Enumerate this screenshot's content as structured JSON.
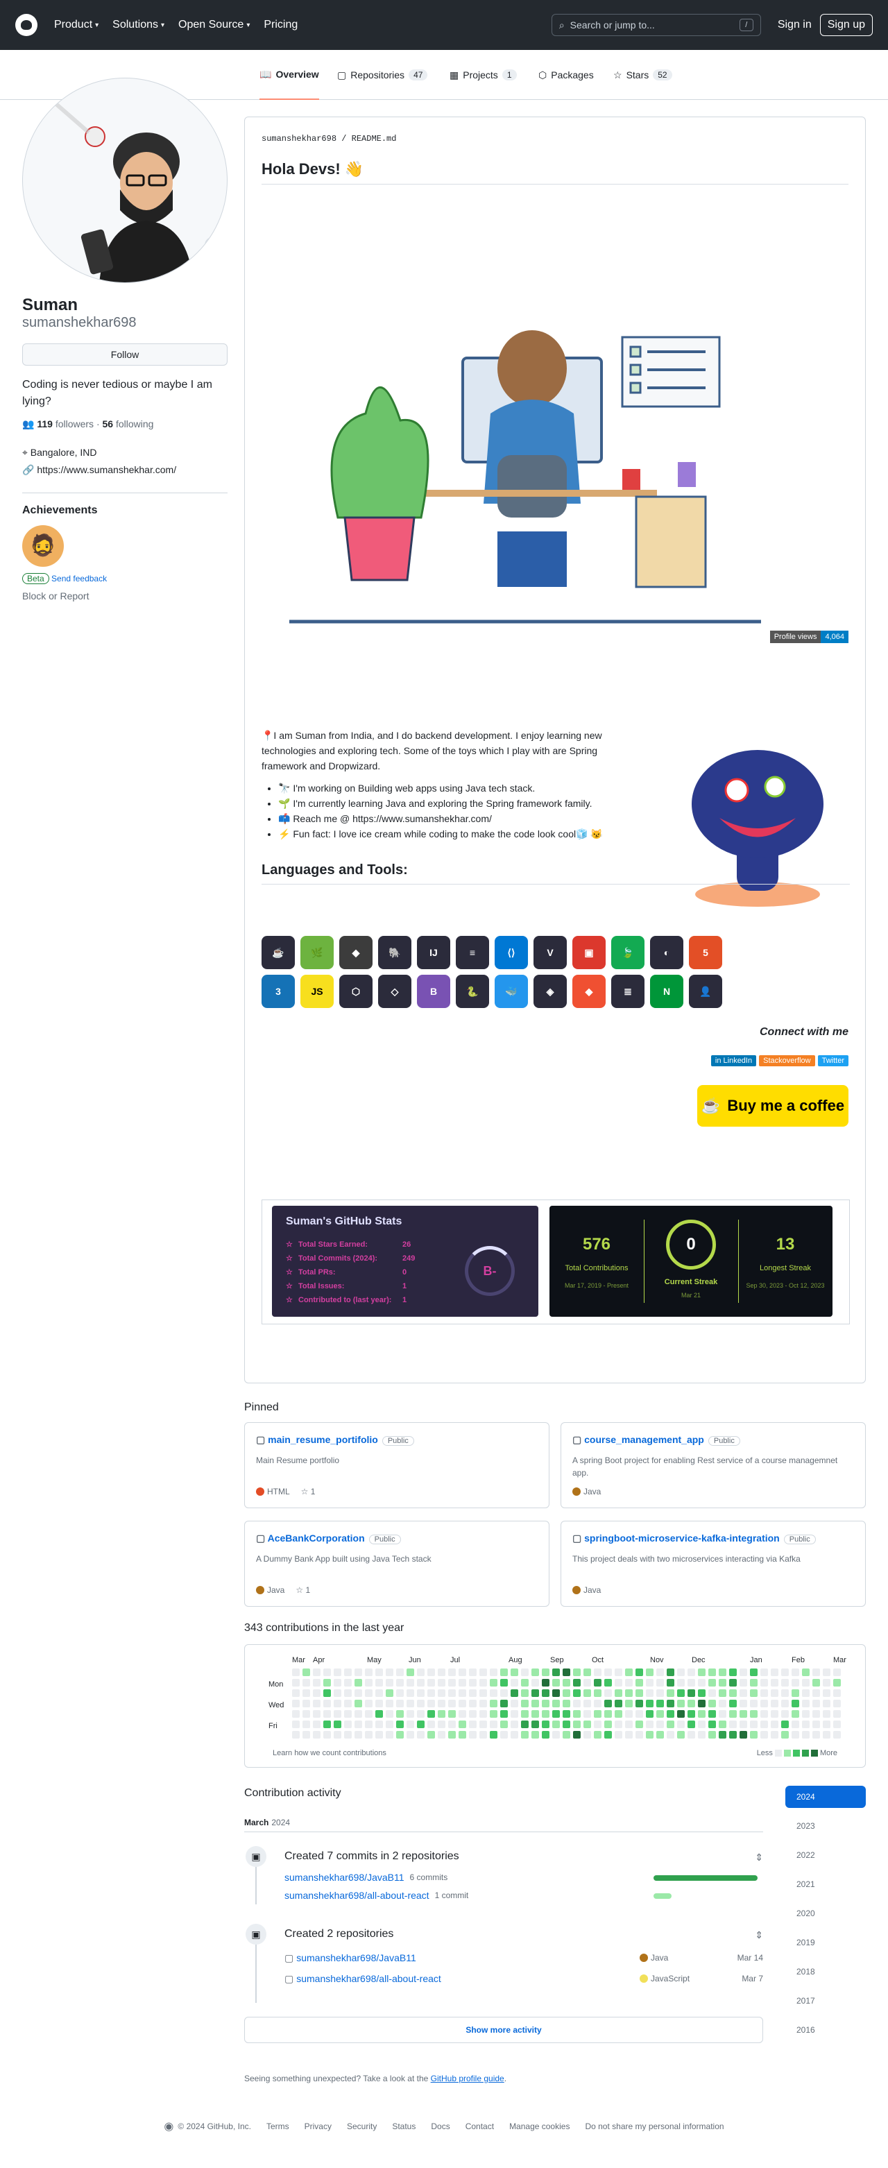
{
  "header": {
    "nav": [
      "Product",
      "Solutions",
      "Open Source",
      "Pricing"
    ],
    "search_placeholder": "Search or jump to...",
    "search_key": "/",
    "signin": "Sign in",
    "signup": "Sign up"
  },
  "tabs": [
    {
      "label": "Overview"
    },
    {
      "label": "Repositories",
      "count": "47"
    },
    {
      "label": "Projects",
      "count": "1"
    },
    {
      "label": "Packages"
    },
    {
      "label": "Stars",
      "count": "52"
    }
  ],
  "profile": {
    "name": "Suman",
    "login": "sumanshekhar698",
    "follow": "Follow",
    "bio": "Coding is never tedious or maybe I am lying?",
    "followers": "119",
    "followers_label": "followers",
    "following": "56",
    "following_label": "following",
    "location": "Bangalore, IND",
    "website": "https://www.sumanshekhar.com/",
    "achievements": "Achievements",
    "beta": "Beta",
    "feedback": "Send feedback",
    "block": "Block or Report"
  },
  "readme": {
    "path_user": "sumanshekhar698",
    "path_file": "README.md",
    "title": "Hola Devs! 👋",
    "views_label": "Profile views",
    "views": "4,064",
    "intro": "📍I am Suman from India, and I do backend development. I enjoy learning new technologies and exploring tech. Some of the toys which I play with are Spring framework and Dropwizard.",
    "bullets": [
      "🔭 I'm working on Building web apps using Java tech stack.",
      "🌱 I'm currently learning Java and exploring the Spring framework family.",
      "📫 Reach me @ https://www.sumanshekhar.com/",
      "⚡ Fun fact: I love ice cream while coding to make the code look cool🧊 😼"
    ],
    "languages_title": "Languages and Tools:",
    "tools": [
      {
        "t": "☕",
        "c": "#2b2b3b"
      },
      {
        "t": "🌿",
        "c": "#6db33f"
      },
      {
        "t": "◆",
        "c": "#3c3c3c"
      },
      {
        "t": "🐘",
        "c": "#2b2b3b"
      },
      {
        "t": "IJ",
        "c": "#2b2b3b"
      },
      {
        "t": "≡",
        "c": "#2b2b3b"
      },
      {
        "t": "⟨⟩",
        "c": "#0078d4"
      },
      {
        "t": "V",
        "c": "#2b2b3b"
      },
      {
        "t": "▣",
        "c": "#dc382d"
      },
      {
        "t": "🍃",
        "c": "#13aa52"
      },
      {
        "t": "◐",
        "c": "#2b2b3b"
      },
      {
        "t": "5",
        "c": "#e34f26"
      },
      {
        "t": "3",
        "c": "#1572b6"
      },
      {
        "t": "JS",
        "c": "#f7df1e"
      },
      {
        "t": "⬡",
        "c": "#2b2b3b"
      },
      {
        "t": "◇",
        "c": "#2b2b3b"
      },
      {
        "t": "B",
        "c": "#7952b3"
      },
      {
        "t": "🐍",
        "c": "#2b2b3b"
      },
      {
        "t": "🐳",
        "c": "#2496ed"
      },
      {
        "t": "◈",
        "c": "#2b2b3b"
      },
      {
        "t": "◆",
        "c": "#f05032"
      },
      {
        "t": "≣",
        "c": "#2b2b3b"
      },
      {
        "t": "N",
        "c": "#009639"
      },
      {
        "t": "👤",
        "c": "#2b2b3b"
      }
    ],
    "connect": "Connect with me",
    "badges": [
      {
        "t": "in LinkedIn",
        "c": "#0077b5"
      },
      {
        "t": "Stackoverflow",
        "c": "#f48024"
      },
      {
        "t": "Twitter",
        "c": "#1da1f2"
      }
    ],
    "coffee": "Buy me a coffee",
    "stats": {
      "title": "Suman's GitHub Stats",
      "rows": [
        [
          "Total Stars Earned:",
          "26"
        ],
        [
          "Total Commits (2024):",
          "249"
        ],
        [
          "Total PRs:",
          "0"
        ],
        [
          "Total Issues:",
          "1"
        ],
        [
          "Contributed to (last year):",
          "1"
        ]
      ],
      "grade": "B-"
    },
    "streak": {
      "total": "576",
      "total_label": "Total Contributions",
      "total_range": "Mar 17, 2019 - Present",
      "current": "0",
      "current_label": "Current Streak",
      "current_range": "Mar 21",
      "longest": "13",
      "longest_label": "Longest Streak",
      "longest_range": "Sep 30, 2023 - Oct 12, 2023"
    }
  },
  "pinned": {
    "title": "Pinned",
    "items": [
      {
        "name": "main_resume_portifolio",
        "vis": "Public",
        "desc": "Main Resume portfolio",
        "lang": "HTML",
        "color": "#e34c26",
        "stars": "1"
      },
      {
        "name": "course_management_app",
        "vis": "Public",
        "desc": "A spring Boot project for enabling Rest service of a course managemnet app.",
        "lang": "Java",
        "color": "#b07219",
        "stars": ""
      },
      {
        "name": "AceBankCorporation",
        "vis": "Public",
        "desc": "A Dummy Bank App built using Java Tech stack",
        "lang": "Java",
        "color": "#b07219",
        "stars": "1"
      },
      {
        "name": "springboot-microservice-kafka-integration",
        "vis": "Public",
        "desc": "This project deals with two microservices interacting via Kafka",
        "lang": "Java",
        "color": "#b07219",
        "stars": ""
      }
    ]
  },
  "contrib": {
    "title": "343 contributions in the last year",
    "months": [
      "Mar",
      "Apr",
      "May",
      "Jun",
      "Jul",
      "Aug",
      "Sep",
      "Oct",
      "Nov",
      "Dec",
      "Jan",
      "Feb",
      "Mar"
    ],
    "days": [
      "Mon",
      "Wed",
      "Fri"
    ],
    "learn": "Learn how we count contributions",
    "less": "Less",
    "more": "More"
  },
  "activity": {
    "title": "Contribution activity",
    "month": "March",
    "year": "2024",
    "commits_title": "Created 7 commits in 2 repositories",
    "commits": [
      {
        "repo": "sumanshekhar698/JavaB11",
        "n": "6 commits",
        "frac": 1
      },
      {
        "repo": "sumanshekhar698/all-about-react",
        "n": "1 commit",
        "frac": 0.17
      }
    ],
    "repos_title": "Created 2 repositories",
    "repos": [
      {
        "repo": "sumanshekhar698/JavaB11",
        "lang": "Java",
        "color": "#b07219",
        "date": "Mar 14"
      },
      {
        "repo": "sumanshekhar698/all-about-react",
        "lang": "JavaScript",
        "color": "#f1e05a",
        "date": "Mar 7"
      }
    ],
    "more": "Show more activity",
    "unexpected": "Seeing something unexpected? Take a look at the",
    "guide": "GitHub profile guide",
    "period": "."
  },
  "years": [
    "2024",
    "2023",
    "2022",
    "2021",
    "2020",
    "2019",
    "2018",
    "2017",
    "2016"
  ],
  "footer": [
    "© 2024 GitHub, Inc.",
    "Terms",
    "Privacy",
    "Security",
    "Status",
    "Docs",
    "Contact",
    "Manage cookies",
    "Do not share my personal information"
  ]
}
